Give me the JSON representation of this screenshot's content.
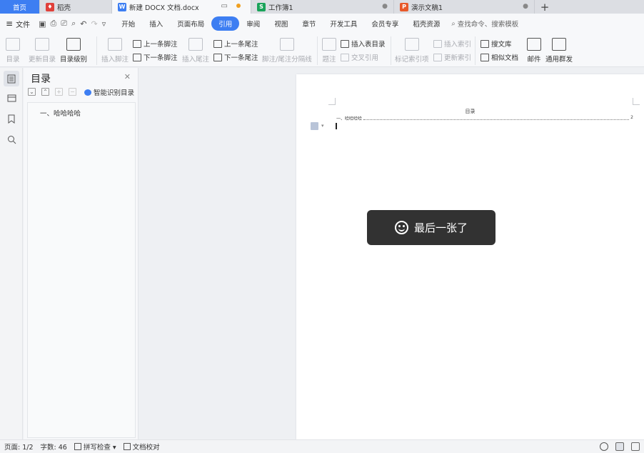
{
  "tabs": [
    {
      "label": "首页",
      "icon": "home"
    },
    {
      "label": "稻壳",
      "icon": "docer-icon"
    },
    {
      "label": "新建 DOCX 文档.docx",
      "icon": "word-doc-icon"
    },
    {
      "label": "工作簿1",
      "icon": "spreadsheet-icon"
    },
    {
      "label": "演示文稿1",
      "icon": "presentation-icon"
    }
  ],
  "new_tab": "+",
  "menu": {
    "file": "文件",
    "items": [
      "开始",
      "插入",
      "页面布局",
      "引用",
      "审阅",
      "视图",
      "章节",
      "开发工具",
      "会员专享",
      "稻壳资源"
    ],
    "active": "引用",
    "search_placeholder": "查找命令、搜索模板"
  },
  "ribbon": {
    "toc": "目录",
    "update_toc": "更新目录",
    "toc_level": "目录级别",
    "insert_footnote": "插入脚注",
    "prev_footnote": "上一条脚注",
    "next_footnote": "下一条脚注",
    "insert_endnote": "插入尾注",
    "prev_endnote": "上一条尾注",
    "next_endnote": "下一条尾注",
    "separator": "脚注/尾注分隔线",
    "caption": "题注",
    "insert_table_toc": "插入表目录",
    "cross_ref": "交叉引用",
    "mark_index": "标记索引项",
    "insert_index": "插入索引",
    "update_index": "更新索引",
    "search_lib": "搜文库",
    "similar_doc": "相似文档",
    "mail": "邮件",
    "mass_send": "通用群发"
  },
  "toc_panel": {
    "title": "目录",
    "smart": "智能识别目录",
    "entry": "一、哈哈哈哈"
  },
  "document": {
    "toc_title": "目录",
    "toc_line_text": "一、哈哈哈哈",
    "toc_line_page": "2"
  },
  "toast": {
    "text": "最后一张了"
  },
  "status": {
    "page": "页面: 1/2",
    "words": "字数: 46",
    "spell": "拼写检查",
    "proof": "文档校对"
  },
  "colors": {
    "accent": "#3d7ef2",
    "toast_bg": "#323232"
  }
}
